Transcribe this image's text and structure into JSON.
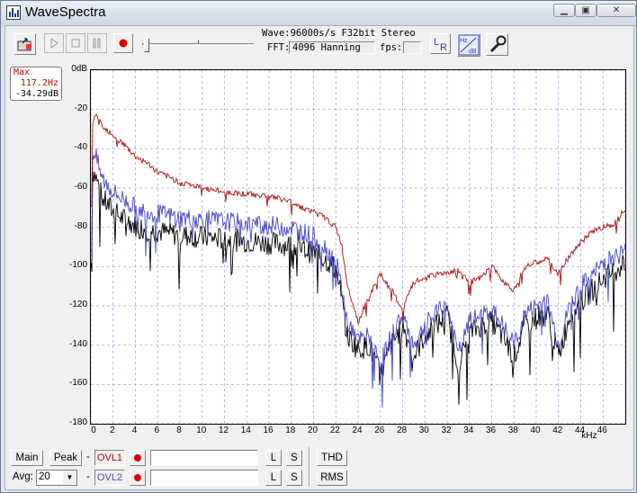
{
  "window": {
    "title": "WaveSpectra"
  },
  "toolbar": {
    "wave_info": "Wave:96000s/s F32bit Stereo",
    "fft_label": "FFT:",
    "fft_value": "4096 Hanning",
    "fps_label": "fps:",
    "fps_value": "",
    "lr_label": "LR",
    "hz_label": "Hz",
    "db_label": "dB"
  },
  "readout": {
    "mode": "Max",
    "freq": "117.2Hz",
    "level": "-34.29dB"
  },
  "chart_data": {
    "type": "line",
    "xlabel": "kHz",
    "ylabel": "",
    "ylim": [
      -180,
      0
    ],
    "xlim": [
      0,
      48
    ],
    "y_ticks": [
      "0dB",
      "-20",
      "-40",
      "-60",
      "-80",
      "-100",
      "-120",
      "-140",
      "-160",
      "-180"
    ],
    "x_ticks": [
      "0",
      "2",
      "4",
      "6",
      "8",
      "10",
      "12",
      "14",
      "16",
      "18",
      "20",
      "22",
      "24",
      "26",
      "28",
      "30",
      "32",
      "34",
      "36",
      "38",
      "40",
      "42",
      "44",
      "46"
    ],
    "grid": true,
    "series": [
      {
        "color": "#b01010",
        "x": [
          0.1,
          0.5,
          1,
          2,
          3,
          4,
          5,
          6,
          8,
          10,
          12,
          14,
          16,
          18,
          19,
          20,
          21,
          22,
          22.5,
          23,
          24,
          25,
          26,
          27,
          28,
          29,
          30,
          31,
          32,
          33,
          34,
          35,
          36,
          37,
          38,
          39,
          40,
          41,
          42,
          43,
          44,
          45,
          46,
          47,
          48
        ],
        "y": [
          -26,
          -22,
          -28,
          -33,
          -38,
          -44,
          -47,
          -52,
          -57,
          -60,
          -62,
          -63,
          -64,
          -67,
          -70,
          -72,
          -75,
          -80,
          -88,
          -108,
          -128,
          -115,
          -104,
          -112,
          -122,
          -108,
          -106,
          -104,
          -103,
          -102,
          -108,
          -106,
          -100,
          -107,
          -112,
          -100,
          -98,
          -96,
          -104,
          -94,
          -88,
          -82,
          -80,
          -78,
          -70
        ]
      },
      {
        "color": "#4646c8",
        "x": [
          0.1,
          0.5,
          1,
          2,
          3,
          4,
          5,
          6,
          8,
          10,
          12,
          14,
          16,
          18,
          19,
          20,
          21,
          22,
          22.5,
          23,
          24,
          25,
          26,
          27,
          28,
          29,
          30,
          31,
          32,
          33,
          34,
          35,
          36,
          37,
          38,
          39,
          40,
          41,
          42,
          43,
          44,
          45,
          46,
          47,
          48
        ],
        "y": [
          -40,
          -45,
          -55,
          -62,
          -66,
          -70,
          -72,
          -73,
          -75,
          -76,
          -77,
          -78,
          -79,
          -80,
          -82,
          -85,
          -90,
          -97,
          -110,
          -128,
          -138,
          -135,
          -150,
          -135,
          -124,
          -140,
          -130,
          -124,
          -120,
          -145,
          -128,
          -125,
          -122,
          -130,
          -140,
          -124,
          -120,
          -118,
          -140,
          -120,
          -110,
          -105,
          -98,
          -95,
          -92
        ]
      },
      {
        "color": "#000000",
        "x": [
          0.1,
          0.5,
          1,
          2,
          3,
          4,
          5,
          6,
          8,
          10,
          12,
          14,
          16,
          18,
          19,
          20,
          21,
          22,
          22.5,
          23,
          24,
          25,
          26,
          27,
          28,
          29,
          30,
          31,
          32,
          33,
          34,
          35,
          36,
          37,
          38,
          39,
          40,
          41,
          42,
          43,
          44,
          45,
          46,
          47,
          48
        ],
        "y": [
          -50,
          -55,
          -65,
          -72,
          -76,
          -79,
          -81,
          -82,
          -84,
          -85,
          -86,
          -87,
          -88,
          -89,
          -91,
          -93,
          -96,
          -101,
          -115,
          -135,
          -142,
          -140,
          -155,
          -140,
          -130,
          -146,
          -135,
          -130,
          -125,
          -150,
          -134,
          -130,
          -128,
          -136,
          -146,
          -130,
          -126,
          -124,
          -146,
          -125,
          -118,
          -112,
          -106,
          -102,
          -98
        ]
      }
    ]
  },
  "bottom": {
    "main_label": "Main",
    "peak_label": "Peak",
    "avg_label": "Avg:",
    "avg_value": "20",
    "dash": "-",
    "ovl1_label": "OVL1",
    "ovl2_label": "OVL2",
    "l_label": "L",
    "s_label": "S",
    "thd_label": "THD",
    "rms_label": "RMS",
    "ovl_color": "#c00000"
  }
}
